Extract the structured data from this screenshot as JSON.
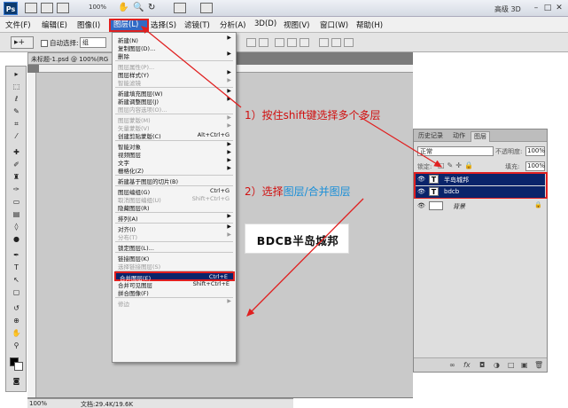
{
  "app": {
    "logo": "Ps",
    "zoom": "100%",
    "workspace": "高级 3D",
    "window_buttons": [
      "–",
      "□",
      "✕"
    ]
  },
  "menubar": [
    "文件(F)",
    "编辑(E)",
    "图像(I)",
    "图层(L)",
    "选择(S)",
    "滤镜(T)",
    "分析(A)",
    "3D(D)",
    "视图(V)",
    "窗口(W)",
    "帮助(H)"
  ],
  "options": {
    "auto_select": "自动选择:",
    "auto_select_value": "组"
  },
  "document": {
    "tab_title": "未标题-1.psd @ 100%(RG",
    "status_zoom": "100%",
    "status_doc": "文档:29.4K/19.6K"
  },
  "layer_menu": {
    "items": [
      {
        "label": "新建(N)",
        "arrow": true
      },
      {
        "label": "复制图层(D)..."
      },
      {
        "label": "删除",
        "arrow": true
      },
      {
        "sep": true
      },
      {
        "label": "图层属性(P)...",
        "disabled": true
      },
      {
        "label": "图层样式(Y)",
        "arrow": true
      },
      {
        "label": "智能滤镜",
        "disabled": true,
        "arrow": true
      },
      {
        "sep": true
      },
      {
        "label": "新建填充图层(W)",
        "arrow": true
      },
      {
        "label": "新建调整图层(J)",
        "arrow": true
      },
      {
        "label": "图层内容选项(O)...",
        "disabled": true
      },
      {
        "sep": true
      },
      {
        "label": "图层蒙版(M)",
        "disabled": true,
        "arrow": true
      },
      {
        "label": "矢量蒙版(V)",
        "disabled": true,
        "arrow": true
      },
      {
        "label": "创建剪贴蒙版(C)",
        "shortcut": "Alt+Ctrl+G"
      },
      {
        "sep": true
      },
      {
        "label": "智能对象",
        "arrow": true
      },
      {
        "label": "视频图层",
        "arrow": true
      },
      {
        "label": "文字",
        "arrow": true
      },
      {
        "label": "栅格化(Z)",
        "arrow": true
      },
      {
        "sep": true
      },
      {
        "label": "新建基于图层的切片(B)"
      },
      {
        "sep": true
      },
      {
        "label": "图层编组(G)",
        "shortcut": "Ctrl+G"
      },
      {
        "label": "取消图层编组(U)",
        "shortcut": "Shift+Ctrl+G",
        "disabled": true
      },
      {
        "label": "隐藏图层(R)"
      },
      {
        "sep": true
      },
      {
        "label": "排列(A)",
        "arrow": true
      },
      {
        "sep": true
      },
      {
        "label": "对齐(I)",
        "arrow": true
      },
      {
        "label": "分布(T)",
        "disabled": true,
        "arrow": true
      },
      {
        "sep": true
      },
      {
        "label": "锁定图层(L)..."
      },
      {
        "sep": true
      },
      {
        "label": "链接图层(K)"
      },
      {
        "label": "选择链接图层(S)",
        "disabled": true
      },
      {
        "sep": true
      },
      {
        "label": "合并图层(E)",
        "shortcut": "Ctrl+E",
        "highlight": true
      },
      {
        "label": "合并可见图层",
        "shortcut": "Shift+Ctrl+E"
      },
      {
        "label": "拼合图像(F)"
      },
      {
        "sep": true
      },
      {
        "label": "修边",
        "disabled": true,
        "arrow": true
      }
    ]
  },
  "logo_text": "BDCB半岛城邦",
  "annotations": {
    "step1": "1）按住shift键选择多个多层",
    "step2_prefix": "2）选择",
    "step2_highlight": "图层/合并图层"
  },
  "layers_panel": {
    "tabs": [
      "历史记录",
      "动作",
      "图层"
    ],
    "blend_mode": "正常",
    "opacity_label": "不透明度:",
    "opacity": "100%",
    "lock_label": "锁定:",
    "fill_label": "填充:",
    "fill": "100%",
    "layers": [
      {
        "name": "半岛城邦",
        "selected": true,
        "thumb": "T"
      },
      {
        "name": "bdcb",
        "selected": true,
        "thumb": "T"
      },
      {
        "name": "背景",
        "selected": false,
        "thumb": ""
      }
    ],
    "bottom_icons": [
      "∞",
      "fx",
      "◘",
      "◑",
      "□",
      "▣",
      "🗑"
    ]
  },
  "colors": {
    "highlight_red": "#e02020",
    "annotation_blue": "#1a8fd8",
    "selection": "#0a246a"
  }
}
